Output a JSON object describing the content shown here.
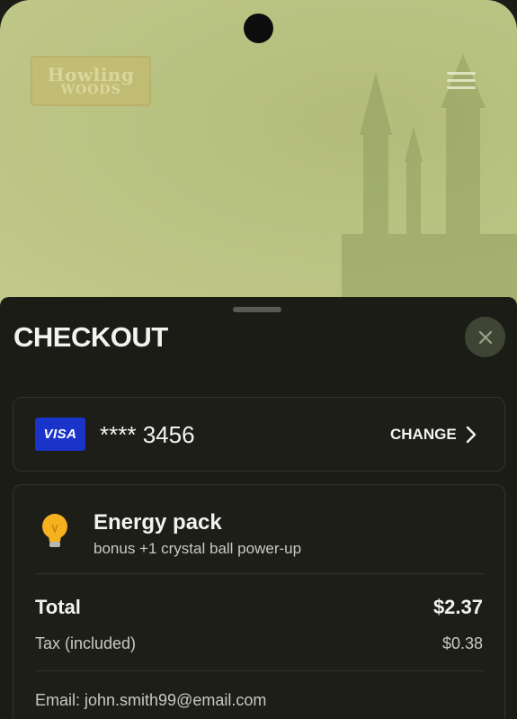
{
  "hero": {
    "logo_line1": "Howling",
    "logo_line2": "WOODS",
    "menu_icon": "hamburger-menu-icon"
  },
  "checkout": {
    "title": "CHECKOUT",
    "close_icon": "close-icon"
  },
  "payment": {
    "card_brand": "VISA",
    "card_number": "**** 3456",
    "change_label": "CHANGE",
    "change_icon": "chevron-right-icon"
  },
  "order": {
    "item_icon": "lightbulb-icon",
    "item_name": "Energy pack",
    "item_description": "bonus +1 crystal ball power-up",
    "total_label": "Total",
    "total_value": "$2.37",
    "tax_label": "Tax (included)",
    "tax_value": "$0.38",
    "email_text": "Email: john.smith99@email.com"
  },
  "colors": {
    "sheet_background": "#1c1c17",
    "hero_background": "#b8c281",
    "visa_blue": "#1a33c9",
    "bulb_yellow": "#f5b21e"
  }
}
